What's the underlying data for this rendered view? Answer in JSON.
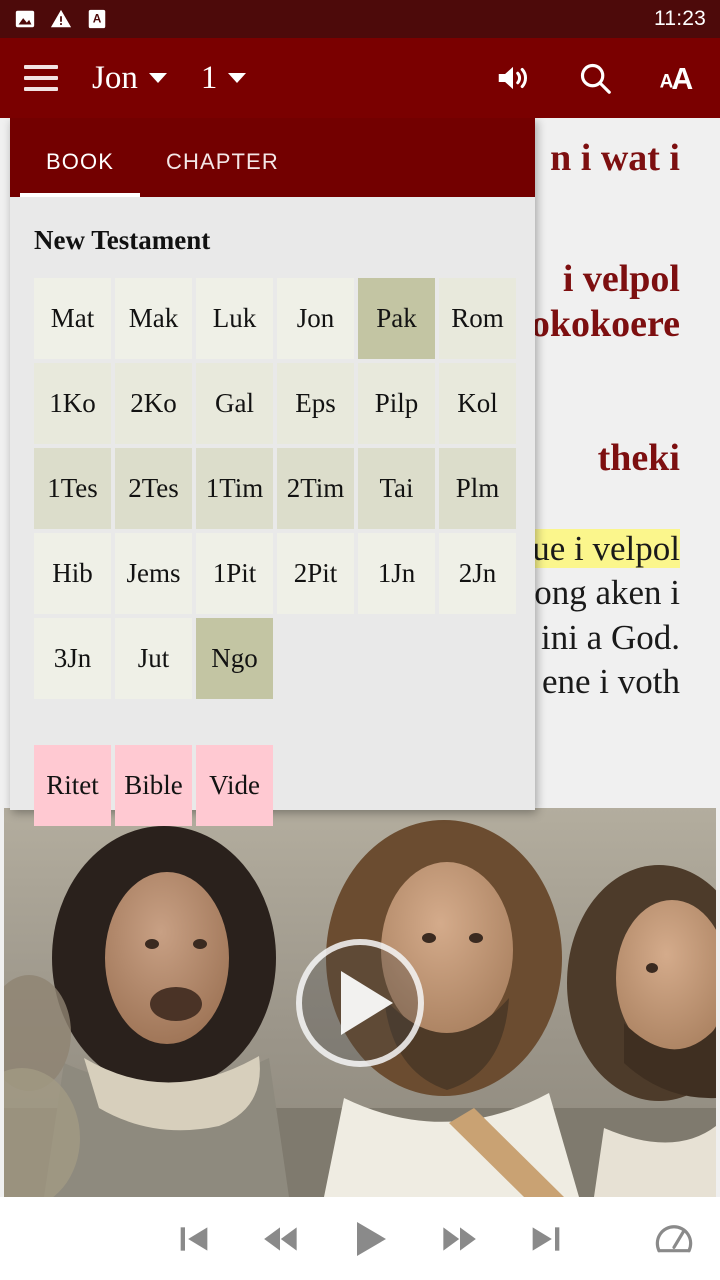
{
  "statusbar": {
    "time": "11:23",
    "icons": [
      {
        "name": "image-icon"
      },
      {
        "name": "warning-icon"
      },
      {
        "name": "app-a-icon"
      }
    ]
  },
  "toolbar": {
    "menu_icon": "hamburger-menu-icon",
    "book_label": "Jon",
    "chapter_label": "1",
    "actions": [
      {
        "name": "volume-icon",
        "label": "Audio"
      },
      {
        "name": "search-icon",
        "label": "Search"
      },
      {
        "name": "text-size-icon",
        "label": "Text size"
      }
    ]
  },
  "panel": {
    "tabs": [
      {
        "label": "BOOK",
        "active": true
      },
      {
        "label": "CHAPTER",
        "active": false
      }
    ],
    "section_title": "New Testament",
    "books": [
      {
        "label": "Mat",
        "style": "shade-c"
      },
      {
        "label": "Mak",
        "style": "shade-c"
      },
      {
        "label": "Luk",
        "style": "shade-c"
      },
      {
        "label": "Jon",
        "style": "shade-c"
      },
      {
        "label": "Pak",
        "style": "sel"
      },
      {
        "label": "Rom",
        "style": "shade-a"
      },
      {
        "label": "1Ko",
        "style": "shade-a"
      },
      {
        "label": "2Ko",
        "style": "shade-a"
      },
      {
        "label": "Gal",
        "style": "shade-a"
      },
      {
        "label": "Eps",
        "style": "shade-a"
      },
      {
        "label": "Pilp",
        "style": "shade-a"
      },
      {
        "label": "Kol",
        "style": "shade-a"
      },
      {
        "label": "1Tes",
        "style": "shade-b"
      },
      {
        "label": "2Tes",
        "style": "shade-b"
      },
      {
        "label": "1Tim",
        "style": "shade-b"
      },
      {
        "label": "2Tim",
        "style": "shade-b"
      },
      {
        "label": "Tai",
        "style": "shade-b"
      },
      {
        "label": "Plm",
        "style": "shade-b"
      },
      {
        "label": "Hib",
        "style": "shade-c"
      },
      {
        "label": "Jems",
        "style": "shade-c"
      },
      {
        "label": "1Pit",
        "style": "shade-c"
      },
      {
        "label": "2Pit",
        "style": "shade-c"
      },
      {
        "label": "1Jn",
        "style": "shade-c"
      },
      {
        "label": "2Jn",
        "style": "shade-c"
      },
      {
        "label": "3Jn",
        "style": "shade-c"
      },
      {
        "label": "Jut",
        "style": "shade-c"
      },
      {
        "label": "Ngo",
        "style": "sel"
      }
    ],
    "extras": [
      {
        "label": "Ritet",
        "style": "pink"
      },
      {
        "label": "Bible",
        "style": "pink"
      },
      {
        "label": "Vide",
        "style": "pink"
      }
    ]
  },
  "reader": {
    "heading_1": "n i wat i",
    "heading_2_line1": "i velpol",
    "heading_2_line2": "okokoere",
    "heading_3": "theki",
    "body_lines": [
      "ue i velpol",
      "iong aken i",
      "ini a God.",
      "ene i voth"
    ],
    "highlight_line_index": 0
  },
  "video": {
    "play_button": "play-button",
    "alt": "video frame"
  },
  "media_controls": [
    {
      "name": "skip-previous-button"
    },
    {
      "name": "rewind-button"
    },
    {
      "name": "play-button"
    },
    {
      "name": "fast-forward-button"
    },
    {
      "name": "skip-next-button"
    },
    {
      "name": "playback-speed-button"
    }
  ],
  "colors": {
    "statusbar_bg": "#4d0a0a",
    "toolbar_bg": "#7a0000",
    "panel_tabs_bg": "#730000",
    "panel_bg": "#e9e9e9",
    "selected_cell": "#c3c5a3",
    "pink_cell": "#ffc9d2",
    "heading_red": "#7d0f10",
    "highlight_yellow": "#fbf68c"
  }
}
